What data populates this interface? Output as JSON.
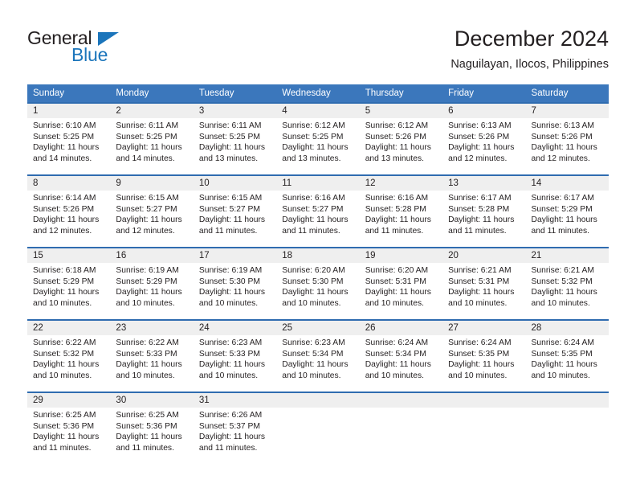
{
  "brand": {
    "line1": "General",
    "line2": "Blue",
    "accent_color": "#1b75bb"
  },
  "header": {
    "title": "December 2024",
    "subtitle": "Naguilayan, Ilocos, Philippines"
  },
  "theme": {
    "header_row_bg": "#3b77bc",
    "day_number_bg": "#efefef",
    "week_divider": "#2f6cb0",
    "text": "#231f20"
  },
  "weekdays": [
    "Sunday",
    "Monday",
    "Tuesday",
    "Wednesday",
    "Thursday",
    "Friday",
    "Saturday"
  ],
  "weeks": [
    [
      {
        "day": "1",
        "sunrise": "Sunrise: 6:10 AM",
        "sunset": "Sunset: 5:25 PM",
        "daylight1": "Daylight: 11 hours",
        "daylight2": "and 14 minutes."
      },
      {
        "day": "2",
        "sunrise": "Sunrise: 6:11 AM",
        "sunset": "Sunset: 5:25 PM",
        "daylight1": "Daylight: 11 hours",
        "daylight2": "and 14 minutes."
      },
      {
        "day": "3",
        "sunrise": "Sunrise: 6:11 AM",
        "sunset": "Sunset: 5:25 PM",
        "daylight1": "Daylight: 11 hours",
        "daylight2": "and 13 minutes."
      },
      {
        "day": "4",
        "sunrise": "Sunrise: 6:12 AM",
        "sunset": "Sunset: 5:25 PM",
        "daylight1": "Daylight: 11 hours",
        "daylight2": "and 13 minutes."
      },
      {
        "day": "5",
        "sunrise": "Sunrise: 6:12 AM",
        "sunset": "Sunset: 5:26 PM",
        "daylight1": "Daylight: 11 hours",
        "daylight2": "and 13 minutes."
      },
      {
        "day": "6",
        "sunrise": "Sunrise: 6:13 AM",
        "sunset": "Sunset: 5:26 PM",
        "daylight1": "Daylight: 11 hours",
        "daylight2": "and 12 minutes."
      },
      {
        "day": "7",
        "sunrise": "Sunrise: 6:13 AM",
        "sunset": "Sunset: 5:26 PM",
        "daylight1": "Daylight: 11 hours",
        "daylight2": "and 12 minutes."
      }
    ],
    [
      {
        "day": "8",
        "sunrise": "Sunrise: 6:14 AM",
        "sunset": "Sunset: 5:26 PM",
        "daylight1": "Daylight: 11 hours",
        "daylight2": "and 12 minutes."
      },
      {
        "day": "9",
        "sunrise": "Sunrise: 6:15 AM",
        "sunset": "Sunset: 5:27 PM",
        "daylight1": "Daylight: 11 hours",
        "daylight2": "and 12 minutes."
      },
      {
        "day": "10",
        "sunrise": "Sunrise: 6:15 AM",
        "sunset": "Sunset: 5:27 PM",
        "daylight1": "Daylight: 11 hours",
        "daylight2": "and 11 minutes."
      },
      {
        "day": "11",
        "sunrise": "Sunrise: 6:16 AM",
        "sunset": "Sunset: 5:27 PM",
        "daylight1": "Daylight: 11 hours",
        "daylight2": "and 11 minutes."
      },
      {
        "day": "12",
        "sunrise": "Sunrise: 6:16 AM",
        "sunset": "Sunset: 5:28 PM",
        "daylight1": "Daylight: 11 hours",
        "daylight2": "and 11 minutes."
      },
      {
        "day": "13",
        "sunrise": "Sunrise: 6:17 AM",
        "sunset": "Sunset: 5:28 PM",
        "daylight1": "Daylight: 11 hours",
        "daylight2": "and 11 minutes."
      },
      {
        "day": "14",
        "sunrise": "Sunrise: 6:17 AM",
        "sunset": "Sunset: 5:29 PM",
        "daylight1": "Daylight: 11 hours",
        "daylight2": "and 11 minutes."
      }
    ],
    [
      {
        "day": "15",
        "sunrise": "Sunrise: 6:18 AM",
        "sunset": "Sunset: 5:29 PM",
        "daylight1": "Daylight: 11 hours",
        "daylight2": "and 10 minutes."
      },
      {
        "day": "16",
        "sunrise": "Sunrise: 6:19 AM",
        "sunset": "Sunset: 5:29 PM",
        "daylight1": "Daylight: 11 hours",
        "daylight2": "and 10 minutes."
      },
      {
        "day": "17",
        "sunrise": "Sunrise: 6:19 AM",
        "sunset": "Sunset: 5:30 PM",
        "daylight1": "Daylight: 11 hours",
        "daylight2": "and 10 minutes."
      },
      {
        "day": "18",
        "sunrise": "Sunrise: 6:20 AM",
        "sunset": "Sunset: 5:30 PM",
        "daylight1": "Daylight: 11 hours",
        "daylight2": "and 10 minutes."
      },
      {
        "day": "19",
        "sunrise": "Sunrise: 6:20 AM",
        "sunset": "Sunset: 5:31 PM",
        "daylight1": "Daylight: 11 hours",
        "daylight2": "and 10 minutes."
      },
      {
        "day": "20",
        "sunrise": "Sunrise: 6:21 AM",
        "sunset": "Sunset: 5:31 PM",
        "daylight1": "Daylight: 11 hours",
        "daylight2": "and 10 minutes."
      },
      {
        "day": "21",
        "sunrise": "Sunrise: 6:21 AM",
        "sunset": "Sunset: 5:32 PM",
        "daylight1": "Daylight: 11 hours",
        "daylight2": "and 10 minutes."
      }
    ],
    [
      {
        "day": "22",
        "sunrise": "Sunrise: 6:22 AM",
        "sunset": "Sunset: 5:32 PM",
        "daylight1": "Daylight: 11 hours",
        "daylight2": "and 10 minutes."
      },
      {
        "day": "23",
        "sunrise": "Sunrise: 6:22 AM",
        "sunset": "Sunset: 5:33 PM",
        "daylight1": "Daylight: 11 hours",
        "daylight2": "and 10 minutes."
      },
      {
        "day": "24",
        "sunrise": "Sunrise: 6:23 AM",
        "sunset": "Sunset: 5:33 PM",
        "daylight1": "Daylight: 11 hours",
        "daylight2": "and 10 minutes."
      },
      {
        "day": "25",
        "sunrise": "Sunrise: 6:23 AM",
        "sunset": "Sunset: 5:34 PM",
        "daylight1": "Daylight: 11 hours",
        "daylight2": "and 10 minutes."
      },
      {
        "day": "26",
        "sunrise": "Sunrise: 6:24 AM",
        "sunset": "Sunset: 5:34 PM",
        "daylight1": "Daylight: 11 hours",
        "daylight2": "and 10 minutes."
      },
      {
        "day": "27",
        "sunrise": "Sunrise: 6:24 AM",
        "sunset": "Sunset: 5:35 PM",
        "daylight1": "Daylight: 11 hours",
        "daylight2": "and 10 minutes."
      },
      {
        "day": "28",
        "sunrise": "Sunrise: 6:24 AM",
        "sunset": "Sunset: 5:35 PM",
        "daylight1": "Daylight: 11 hours",
        "daylight2": "and 10 minutes."
      }
    ],
    [
      {
        "day": "29",
        "sunrise": "Sunrise: 6:25 AM",
        "sunset": "Sunset: 5:36 PM",
        "daylight1": "Daylight: 11 hours",
        "daylight2": "and 11 minutes."
      },
      {
        "day": "30",
        "sunrise": "Sunrise: 6:25 AM",
        "sunset": "Sunset: 5:36 PM",
        "daylight1": "Daylight: 11 hours",
        "daylight2": "and 11 minutes."
      },
      {
        "day": "31",
        "sunrise": "Sunrise: 6:26 AM",
        "sunset": "Sunset: 5:37 PM",
        "daylight1": "Daylight: 11 hours",
        "daylight2": "and 11 minutes."
      },
      {
        "day": "",
        "sunrise": "",
        "sunset": "",
        "daylight1": "",
        "daylight2": ""
      },
      {
        "day": "",
        "sunrise": "",
        "sunset": "",
        "daylight1": "",
        "daylight2": ""
      },
      {
        "day": "",
        "sunrise": "",
        "sunset": "",
        "daylight1": "",
        "daylight2": ""
      },
      {
        "day": "",
        "sunrise": "",
        "sunset": "",
        "daylight1": "",
        "daylight2": ""
      }
    ]
  ]
}
